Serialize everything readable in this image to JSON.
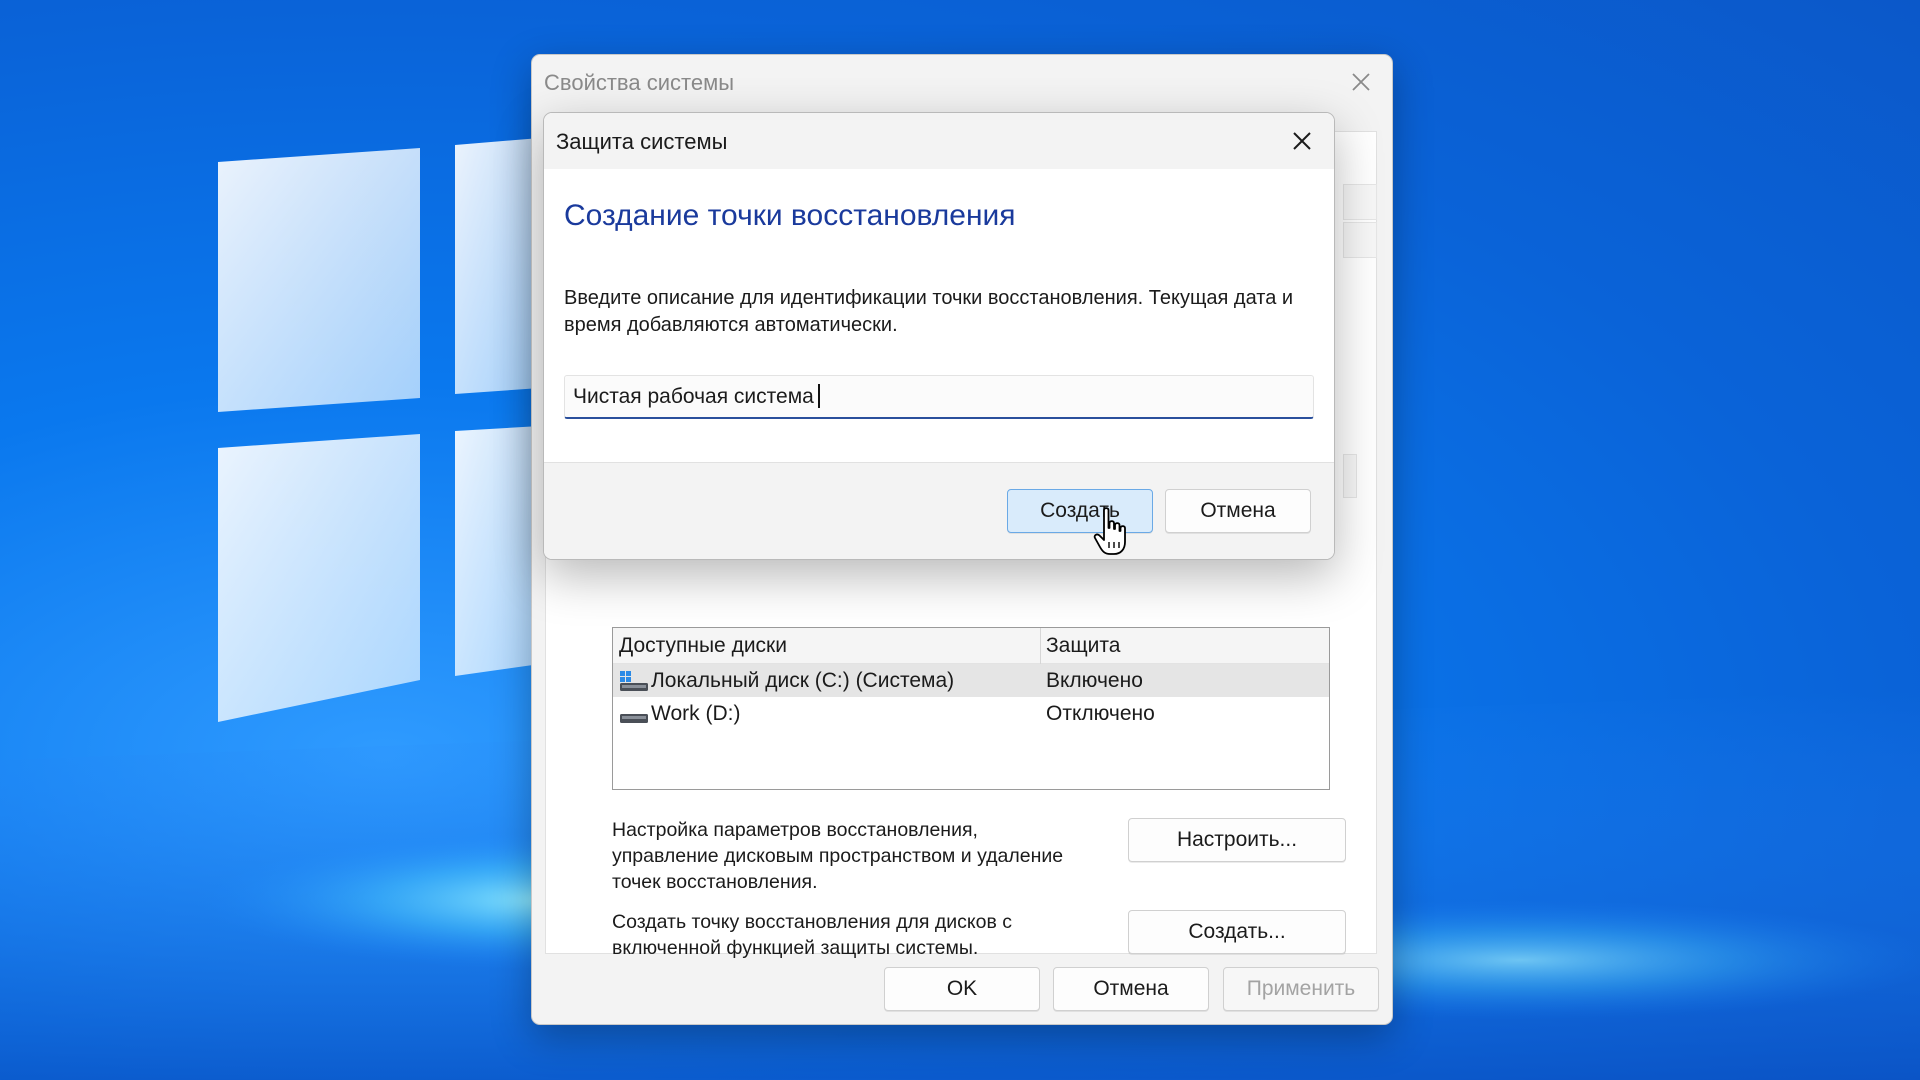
{
  "outer_window": {
    "title": "Свойства системы",
    "available_drives": {
      "columns": [
        "Доступные диски",
        "Защита"
      ],
      "rows": [
        {
          "name": "Локальный диск (C:) (Система)",
          "protection": "Включено",
          "icon": "windows-drive-icon"
        },
        {
          "name": "Work (D:)",
          "protection": "Отключено",
          "icon": "drive-icon"
        }
      ]
    },
    "configure_description": "Настройка параметров восстановления, управление дисковым пространством и удаление точек восстановления.",
    "configure_button": "Настроить...",
    "create_description": "Создать точку восстановления для дисков с включенной функцией защиты системы.",
    "create_button": "Создать...",
    "footer": {
      "ok": "OK",
      "cancel": "Отмена",
      "apply": "Применить"
    }
  },
  "dialog": {
    "title": "Защита системы",
    "heading": "Создание точки восстановления",
    "description": "Введите описание для идентификации точки восстановления. Текущая дата и время добавляются автоматически.",
    "input_value": "Чистая рабочая система",
    "create_button": "Создать",
    "cancel_button": "Отмена"
  },
  "colors": {
    "heading": "#1a3a9c",
    "primary_button_fill": "#d9ebfb",
    "primary_button_border": "#6aa9e6",
    "input_underline": "#2a4f9c",
    "wallpaper": "#0a78ee"
  }
}
